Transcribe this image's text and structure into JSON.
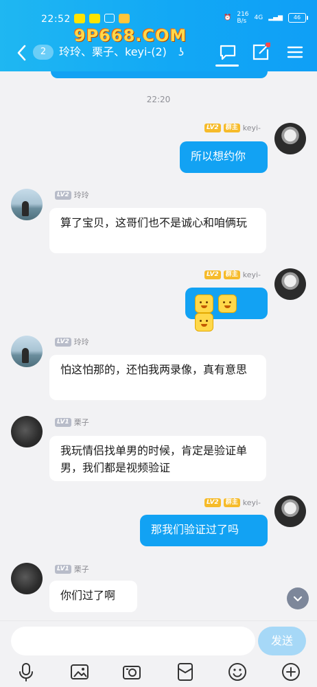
{
  "status_bar": {
    "time": "22:52",
    "net_speed": "216",
    "net_unit": "B/s",
    "signal": "4G",
    "battery": "46"
  },
  "watermark": "9P668.COM",
  "header": {
    "unread_count": "2",
    "title": "玲玲、栗子、keyi-(2)"
  },
  "timestamp": "22:20",
  "messages": [
    {
      "side": "right",
      "level": "LV2",
      "role": "群主",
      "name": "keyi-",
      "text": "所以想约你"
    },
    {
      "side": "left",
      "level": "LV2",
      "name": "玲玲",
      "text": "算了宝贝，这哥们也不是诚心和咱俩玩"
    },
    {
      "side": "right",
      "level": "LV2",
      "role": "群主",
      "name": "keyi-",
      "text": ""
    },
    {
      "side": "left",
      "level": "LV2",
      "name": "玲玲",
      "text": "怕这怕那的，还怕我两录像，真有意思"
    },
    {
      "side": "left",
      "level": "LV1",
      "name": "栗子",
      "text": "我玩情侣找单男的时候，肯定是验证单男，我们都是视频验证"
    },
    {
      "side": "right",
      "level": "LV2",
      "role": "群主",
      "name": "keyi-",
      "text": "那我们验证过了吗"
    },
    {
      "side": "left",
      "level": "LV1",
      "name": "栗子",
      "text": "你们过了啊"
    }
  ],
  "input": {
    "value": "",
    "send_label": "发送"
  },
  "icons": {
    "back": "back-arrow-icon",
    "chat": "chat-bubble-icon",
    "edit": "edit-icon",
    "menu": "menu-icon",
    "scroll_down": "chevron-down-icon",
    "toolbar": [
      "microphone-icon",
      "image-icon",
      "camera-icon",
      "red-packet-icon",
      "emoji-icon",
      "plus-icon"
    ]
  },
  "colors": {
    "header": "#12a8f5",
    "own_bubble": "#12a2f3",
    "send_button": "#a6d8f7",
    "role_badge": "#f6bb2a",
    "level_badge": "#b8bcc9",
    "notification_dot": "#ff4a4a"
  }
}
